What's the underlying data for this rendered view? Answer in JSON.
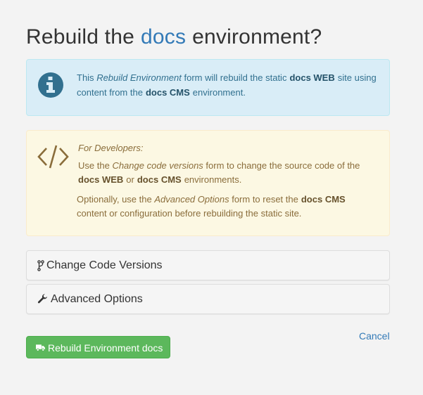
{
  "title": {
    "prefix": "Rebuild the",
    "env_name": "docs",
    "suffix": "environment?"
  },
  "info_alert": {
    "icon": "info-circle-icon",
    "t1": "This",
    "form_name": "Rebuild Environment",
    "t2": "form will rebuild the static",
    "web_env": "docs WEB",
    "t3": "site using content from the",
    "cms_env": "docs CMS",
    "t4": "environment."
  },
  "dev_alert": {
    "icon": "code-icon",
    "heading": "For Developers:",
    "p1_a": "Use the",
    "p1_form": "Change code versions",
    "p1_b": "form to change the source code of the",
    "p1_web": "docs WEB",
    "p1_or": "or",
    "p1_cms": "docs CMS",
    "p1_c": "environments.",
    "p2_a": "Optionally, use the",
    "p2_form": "Advanced Options",
    "p2_b": "form to reset the",
    "p2_cms": "docs CMS",
    "p2_c": "content or configuration before rebuilding the static site."
  },
  "panels": [
    {
      "label": "Change Code Versions",
      "icon": "code-fork-icon"
    },
    {
      "label": "Advanced Options",
      "icon": "wrench-icon"
    }
  ],
  "actions": {
    "cancel": "Cancel",
    "rebuild": "Rebuild Environment docs",
    "rebuild_icon": "truck-icon"
  },
  "colors": {
    "info_bg": "#d9edf7",
    "info_text": "#31708f",
    "warn_bg": "#fcf8e3",
    "warn_text": "#8a6d3b",
    "link": "#337ab7",
    "success": "#5cb85c"
  }
}
